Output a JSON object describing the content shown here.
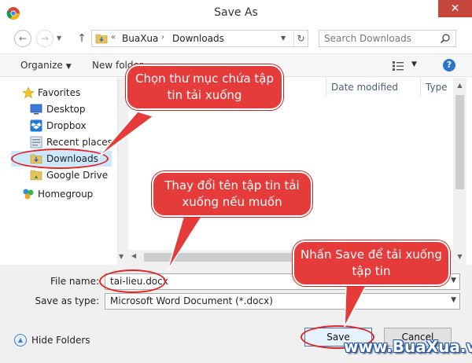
{
  "window": {
    "title": "Save As",
    "close_glyph": "✕"
  },
  "nav": {
    "back_glyph": "←",
    "forward_glyph": "→",
    "up_glyph": "↑",
    "address_prefix": "«",
    "address_parts": [
      "BuaXua",
      "Downloads"
    ],
    "address_separator": "›",
    "search_placeholder": "Search Downloads"
  },
  "toolbar": {
    "organize": "Organize",
    "new_folder": "New folder"
  },
  "sidebar": {
    "items": [
      {
        "label": "Favorites",
        "icon": "star-icon"
      },
      {
        "label": "Desktop",
        "icon": "desktop-icon"
      },
      {
        "label": "Dropbox",
        "icon": "dropbox-icon"
      },
      {
        "label": "Recent places",
        "icon": "recent-places-icon"
      },
      {
        "label": "Downloads",
        "icon": "downloads-folder-icon",
        "selected": true
      },
      {
        "label": "Google Drive",
        "icon": "google-drive-icon"
      },
      {
        "label": "Homegroup",
        "icon": "homegroup-icon"
      }
    ]
  },
  "filelist": {
    "columns": [
      "Date modified",
      "Type"
    ]
  },
  "fields": {
    "file_name_label": "File name:",
    "file_name_value": "tai-lieu.docx",
    "save_type_label": "Save as type:",
    "save_type_value": "Microsoft Word Document (*.docx)"
  },
  "footer": {
    "hide_folders": "Hide Folders",
    "save": "Save",
    "cancel": "Cancel"
  },
  "annotations": {
    "callout_folder": "Chọn thư mục chứa tập tin tải xuống",
    "callout_filename": "Thay đổi tên tập tin tải xuống nếu muốn",
    "callout_save": "Nhấn Save để tải xuống tập tin",
    "watermark": "www.BuaXua.vn"
  },
  "colors": {
    "accent": "#e63b3b",
    "selection": "#cce8ff",
    "close": "#c7463b"
  }
}
